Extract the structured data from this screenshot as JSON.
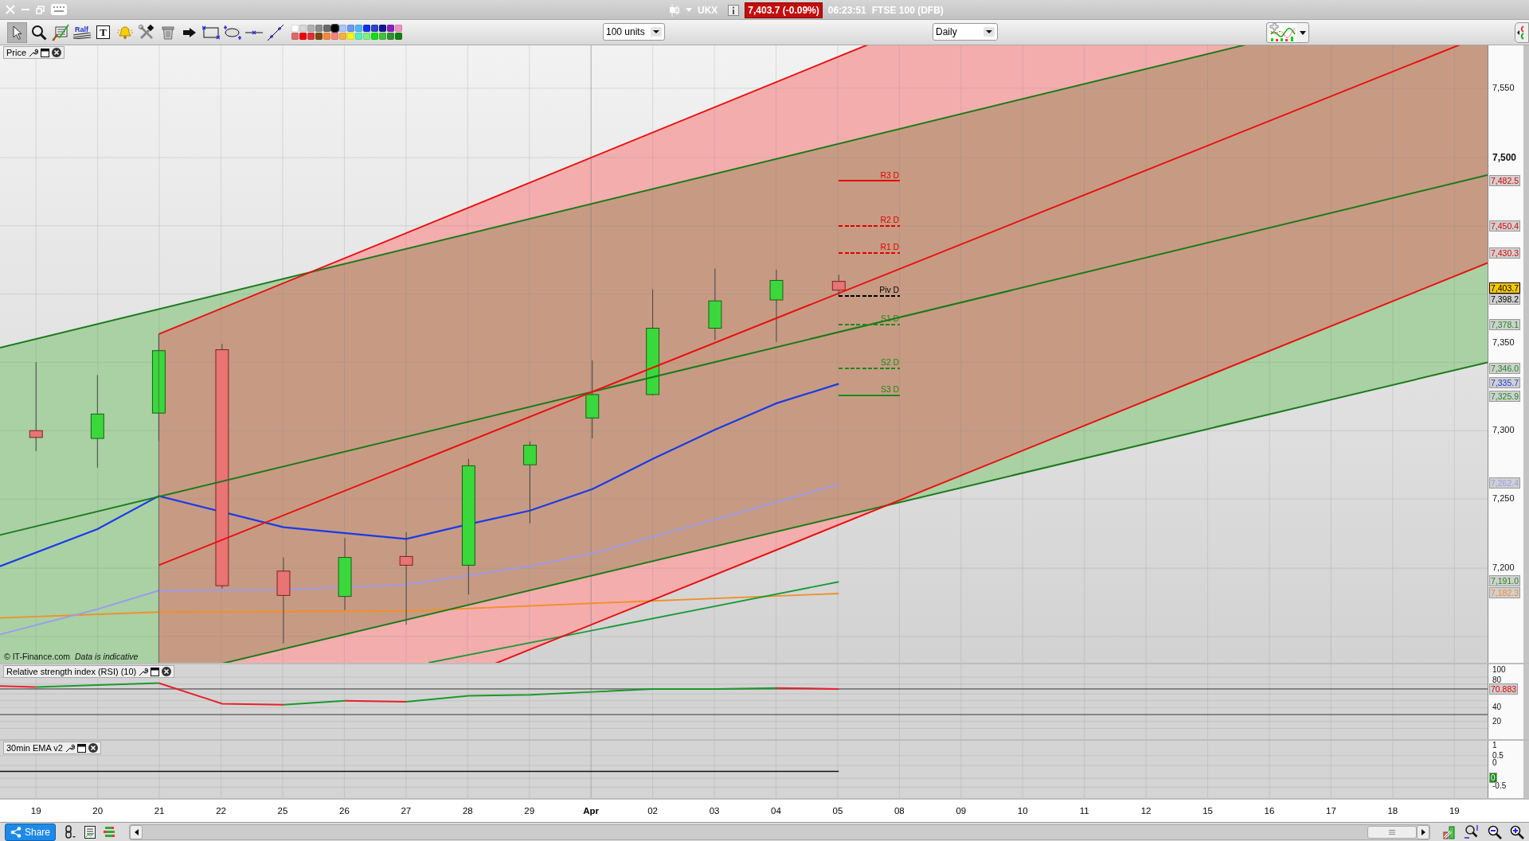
{
  "title_bar": {
    "symbol": "UKX",
    "price_badge": "7,403.7 (-0.09%)",
    "time": "06:23:51",
    "instrument": "FTSE 100 (DFB)"
  },
  "toolbar": {
    "tools": [
      {
        "kind": "pointer",
        "selected": true
      },
      {
        "kind": "zoom",
        "selected": false
      },
      {
        "kind": "trend",
        "selected": false
      },
      {
        "kind": "fibonacci",
        "label": "Ralf",
        "selected": false
      },
      {
        "kind": "text",
        "label": "T",
        "selected": false
      },
      {
        "kind": "alert",
        "selected": false
      },
      {
        "kind": "settings",
        "selected": false
      },
      {
        "kind": "delete",
        "selected": false
      },
      {
        "kind": "arrow",
        "selected": false
      },
      {
        "kind": "rectangle",
        "selected": false
      },
      {
        "kind": "ellipse",
        "selected": false
      },
      {
        "kind": "hline",
        "selected": false
      },
      {
        "kind": "line",
        "selected": false
      }
    ],
    "swatches": [
      {
        "color": "#ffffff",
        "selected": false
      },
      {
        "color": "#d8d8d8",
        "selected": false
      },
      {
        "color": "#b0b0b0",
        "selected": false
      },
      {
        "color": "#8c8c8c",
        "selected": false
      },
      {
        "color": "#6a6a6a",
        "selected": false
      },
      {
        "color": "#000000",
        "selected": true
      },
      {
        "color": "#a8c8f8",
        "selected": false
      },
      {
        "color": "#6a9af0",
        "selected": false
      },
      {
        "color": "#50b8f0",
        "selected": false
      },
      {
        "color": "#1030e8",
        "selected": false
      },
      {
        "color": "#3040c8",
        "selected": false
      },
      {
        "color": "#101890",
        "selected": false
      },
      {
        "color": "#8820c0",
        "selected": false
      },
      {
        "color": "#f090c0",
        "selected": false
      },
      {
        "color": "#e06868",
        "selected": false
      },
      {
        "color": "#f00000",
        "selected": false
      },
      {
        "color": "#e03030",
        "selected": false
      },
      {
        "color": "#7a4a10",
        "selected": false
      },
      {
        "color": "#f88838",
        "selected": false
      },
      {
        "color": "#f88080",
        "selected": false
      },
      {
        "color": "#f8b040",
        "selected": false
      },
      {
        "color": "#f8f800",
        "selected": false
      },
      {
        "color": "#50f0c0",
        "selected": false
      },
      {
        "color": "#80f080",
        "selected": false
      },
      {
        "color": "#10e010",
        "selected": false
      },
      {
        "color": "#40c040",
        "selected": false
      },
      {
        "color": "#309030",
        "selected": false
      },
      {
        "color": "#108010",
        "selected": false
      }
    ],
    "quantity_dropdown": "100 units",
    "interval_dropdown": "Daily"
  },
  "price_panel": {
    "title": "Price",
    "copyright": "© IT-Finance.com",
    "disclaimer": "Data is indicative",
    "pivots": [
      {
        "label": "R3 D",
        "color": "#e00000",
        "dashed": false
      },
      {
        "label": "R2 D",
        "color": "#e00000",
        "dashed": true
      },
      {
        "label": "R1 D",
        "color": "#e00000",
        "dashed": true
      },
      {
        "label": "Piv D",
        "color": "#000000",
        "dashed": true
      },
      {
        "label": "S1 D",
        "color": "#1a8a1a",
        "dashed": true
      },
      {
        "label": "S2 D",
        "color": "#1a8a1a",
        "dashed": true
      },
      {
        "label": "S3 D",
        "color": "#1a8a1a",
        "dashed": false
      }
    ],
    "ticks": [
      {
        "label": "7,550",
        "bold": false
      },
      {
        "label": "7,500",
        "bold": true
      },
      {
        "label": "7,350",
        "bold": false
      },
      {
        "label": "7,300",
        "bold": false
      },
      {
        "label": "7,250",
        "bold": false
      },
      {
        "label": "7,200",
        "bold": false
      }
    ],
    "tags": [
      {
        "label": "7,482.5",
        "color": "#e00000",
        "highlighted": false
      },
      {
        "label": "7,450.4",
        "color": "#e00000",
        "highlighted": false
      },
      {
        "label": "7,430.3",
        "color": "#e00000",
        "highlighted": false
      },
      {
        "label": "7,403.7",
        "color": "#000000",
        "highlighted": true
      },
      {
        "label": "7,398.2",
        "color": "#000000",
        "highlighted": false
      },
      {
        "label": "7,378.1",
        "color": "#1a8a1a",
        "highlighted": false
      },
      {
        "label": "7,346.0",
        "color": "#1a8a1a",
        "highlighted": false
      },
      {
        "label": "7,335.7",
        "color": "#1a3ae0",
        "highlighted": false
      },
      {
        "label": "7,325.9",
        "color": "#1a8a1a",
        "highlighted": false
      },
      {
        "label": "7,262.4",
        "color": "#9a9af0",
        "highlighted": false
      },
      {
        "label": "7,191.0",
        "color": "#1a8a1a",
        "highlighted": false
      },
      {
        "label": "7,182.3",
        "color": "#f08830",
        "highlighted": false
      }
    ]
  },
  "rsi_panel": {
    "title": "Relative strength index (RSI) (10)",
    "ticks": [
      "100",
      "80",
      "40",
      "20"
    ],
    "tag": {
      "label": "70.883",
      "color": "#e00000"
    }
  },
  "ema_panel": {
    "title": "30min EMA v2",
    "ticks": [
      "1",
      "0.5",
      "0",
      "-0.5"
    ],
    "tag": {
      "label": "0",
      "color": "#1a8a1a"
    }
  },
  "date_axis": [
    "19",
    "20",
    "21",
    "22",
    "25",
    "26",
    "27",
    "28",
    "29",
    "Apr",
    "02",
    "03",
    "04",
    "05",
    "08",
    "09",
    "10",
    "11",
    "12",
    "15",
    "16",
    "17",
    "18",
    "19"
  ],
  "bottom_bar": {
    "share": "Share"
  }
}
